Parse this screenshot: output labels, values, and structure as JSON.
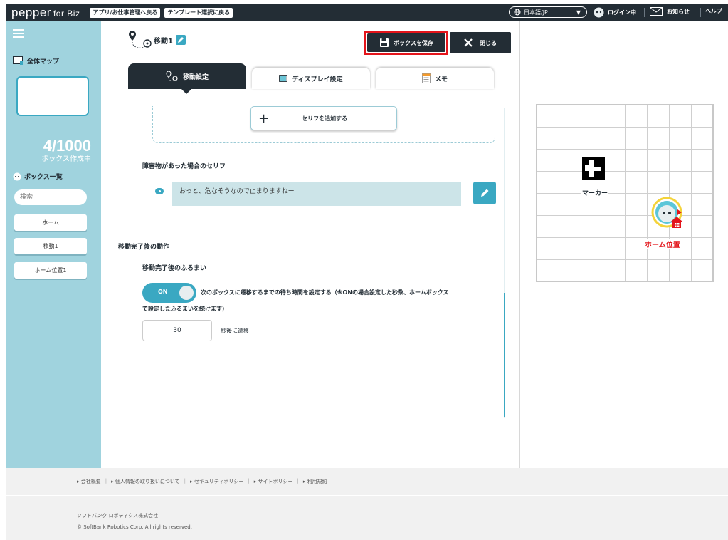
{
  "topbar": {
    "logo": "pepper",
    "logo_suffix": "for Biz",
    "back_to_app": "アプリ/お仕事管理へ戻る",
    "back_to_template": "テンプレート選択に戻る",
    "language": "日本語/JP",
    "login_status": "ログイン中",
    "notifications": "お知らせ",
    "help": "ヘルプ"
  },
  "sidebar": {
    "map_title": "全体マップ",
    "box_count": "4/1000",
    "box_count_label": "ボックス作成中",
    "box_list_title": "ボックス一覧",
    "search_placeholder": "検索",
    "items": [
      {
        "label": "ホーム"
      },
      {
        "label": "移動1"
      },
      {
        "label": "ホーム位置1"
      }
    ]
  },
  "editor": {
    "title": "移動1",
    "save_label": "ボックスを保存",
    "close_label": "閉じる",
    "tabs": [
      {
        "label": "移動設定",
        "active": true
      },
      {
        "label": "ディスプレイ設定",
        "active": false
      },
      {
        "label": "メモ",
        "active": false
      }
    ],
    "add_serif_label": "セリフを追加する",
    "obstacle_label": "障害物があった場合のセリフ",
    "obstacle_text": "おっと、危なそうなので止まりますねー",
    "after_move_title": "移動完了後の動作",
    "after_move_behavior": "移動完了後のふるまい",
    "toggle_label": "ON",
    "toggle_desc_1": "次のボックスに遷移するまでの待ち時間を設定する（※ONの場合設定した秒数、ホームボックス",
    "toggle_desc_2": "で設定したふるまいを続けます）",
    "wait_seconds": "30",
    "wait_suffix": "秒後に遷移"
  },
  "map": {
    "marker_label": "マーカー",
    "home_label": "ホーム位置"
  },
  "footer": {
    "links": [
      "会社概要",
      "個人情報の取り扱いについて",
      "セキュリティポリシー",
      "サイトポリシー",
      "利用規約"
    ],
    "company": "ソフトバンク ロボティクス株式会社",
    "copyright": "© SoftBank Robotics Corp. All rights reserved."
  },
  "colors": {
    "dark": "#232d35",
    "accent": "#3aa8c2",
    "sidebar": "#a0d3de",
    "highlight": "#e3141a"
  }
}
